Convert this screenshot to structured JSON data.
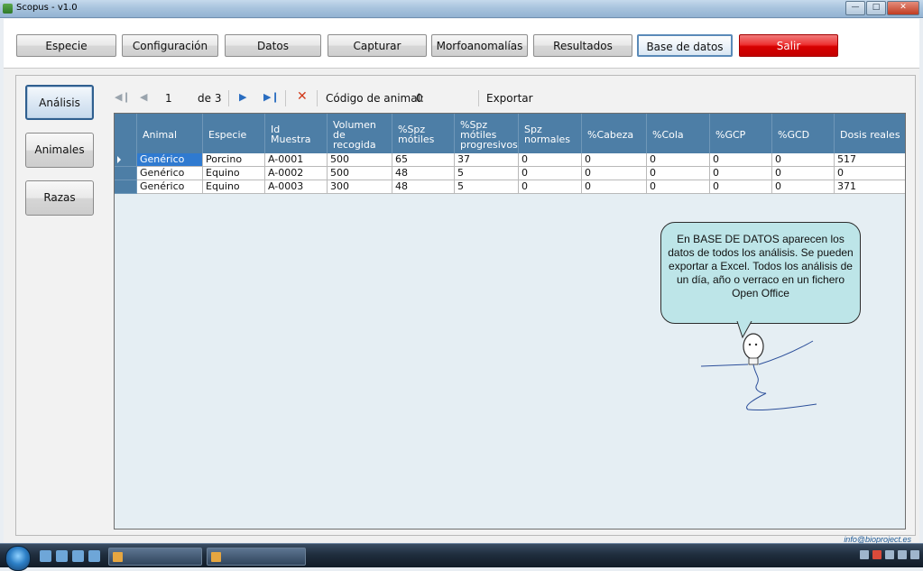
{
  "window": {
    "title": "Scopus - v1.0"
  },
  "toolbar": {
    "buttons": [
      {
        "label": "Especie"
      },
      {
        "label": "Configuración"
      },
      {
        "label": "Datos"
      },
      {
        "label": "Capturar"
      },
      {
        "label": "Morfoanomalías"
      },
      {
        "label": "Resultados"
      },
      {
        "label": "Base de datos"
      },
      {
        "label": "Salir"
      }
    ],
    "active": "Base de datos",
    "danger_color": "#d60000"
  },
  "sidebar": {
    "items": [
      {
        "label": "Análisis"
      },
      {
        "label": "Animales"
      },
      {
        "label": "Razas"
      }
    ],
    "active": "Análisis"
  },
  "navigator": {
    "position": "1",
    "of_label": "de 3",
    "animal_code_label": "Código de animal:",
    "animal_code_value": "0",
    "export_label": "Exportar",
    "icons": [
      "first-icon",
      "prev-icon",
      "next-icon",
      "last-icon",
      "delete-icon"
    ]
  },
  "grid": {
    "header_color": "#4d7ea6",
    "selection_color": "#2f7ad0",
    "columns": [
      "Animal",
      "Especie",
      "Id Muestra",
      "Volumen de recogida",
      "%Spz mótiles",
      "%Spz mótiles progresivos",
      "Spz normales",
      "%Cabeza",
      "%Cola",
      "%GCP",
      "%GCD",
      "Dosis reales"
    ],
    "rows": [
      [
        "Genérico",
        "Porcino",
        "A-0001",
        "500",
        "65",
        "37",
        "0",
        "0",
        "0",
        "0",
        "0",
        "517"
      ],
      [
        "Genérico",
        "Equino",
        "A-0002",
        "500",
        "48",
        "5",
        "0",
        "0",
        "0",
        "0",
        "0",
        "0"
      ],
      [
        "Genérico",
        "Equino",
        "A-0003",
        "300",
        "48",
        "5",
        "0",
        "0",
        "0",
        "0",
        "0",
        "371"
      ]
    ]
  },
  "callout": {
    "text": "En BASE DE DATOS aparecen los datos de todos los análisis. Se pueden exportar a Excel. Todos los análisis de un día, año o verraco en un fichero Open Office",
    "background": "#bde5e8"
  },
  "footer": {
    "email": "info@bioproject.es"
  }
}
